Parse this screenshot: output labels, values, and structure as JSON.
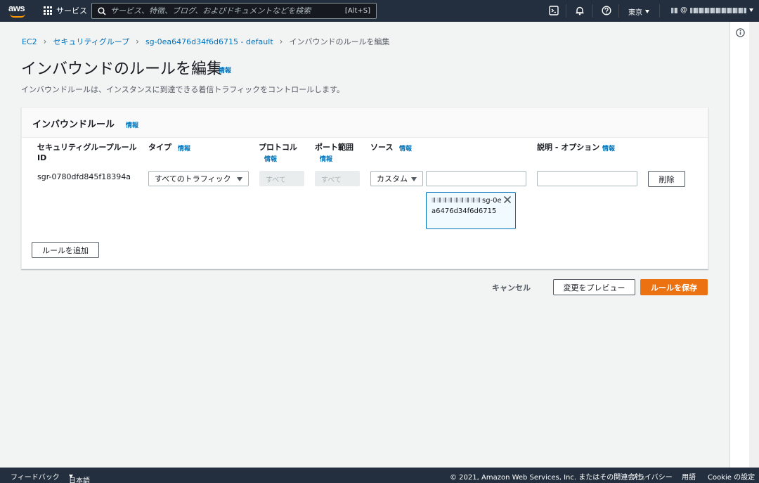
{
  "topnav": {
    "services_label": "サービス",
    "search_placeholder": "サービス、特徴、ブログ、およびドキュメントなどを検索",
    "search_shortcut": "[Alt+S]",
    "region": "東京",
    "account_prefix": "@"
  },
  "breadcrumb": {
    "items": [
      "EC2",
      "セキュリティグループ",
      "sg-0ea6476d34f6d6715 - default"
    ],
    "current": "インバウンドのルールを編集"
  },
  "page": {
    "title": "インバウンドのルールを編集",
    "info": "情報",
    "description": "インバウンドルールは、インスタンスに到達できる着信トラフィックをコントロールします。"
  },
  "card": {
    "title": "インバウンドルール",
    "info": "情報",
    "columns": {
      "rule_id_line1": "セキュリティグループルール",
      "rule_id_line2": "ID",
      "type": "タイプ",
      "protocol": "プロトコル",
      "port_range": "ポート範囲",
      "source": "ソース",
      "description": "説明 - オプション",
      "info": "情報"
    },
    "row": {
      "rule_id": "sgr-0780dfd845f18394a",
      "type": "すべてのトラフィック",
      "protocol": "すべて",
      "port_range": "すべて",
      "source_type": "カスタム",
      "source_search": "",
      "token_text": "sg-0ea6476d34f6d6715",
      "description": "",
      "delete_label": "削除"
    },
    "add_rule_label": "ルールを追加"
  },
  "actions": {
    "cancel": "キャンセル",
    "preview": "変更をプレビュー",
    "save": "ルールを保存"
  },
  "footer": {
    "feedback": "フィードバック",
    "language": "日本語",
    "copyright": "© 2021, Amazon Web Services, Inc. またはその関連会社。",
    "privacy": "プライバシー",
    "terms": "用語",
    "cookie": "Cookie の設定"
  },
  "colors": {
    "nav_bg": "#232f3e",
    "link": "#0073bb",
    "primary": "#ec7211",
    "page_bg": "#f2f3f3"
  },
  "icons": [
    "aws-logo",
    "grid-icon",
    "search-icon",
    "cloudshell-icon",
    "bell-icon",
    "help-icon",
    "info-icon",
    "close-icon",
    "caret-down-icon"
  ]
}
